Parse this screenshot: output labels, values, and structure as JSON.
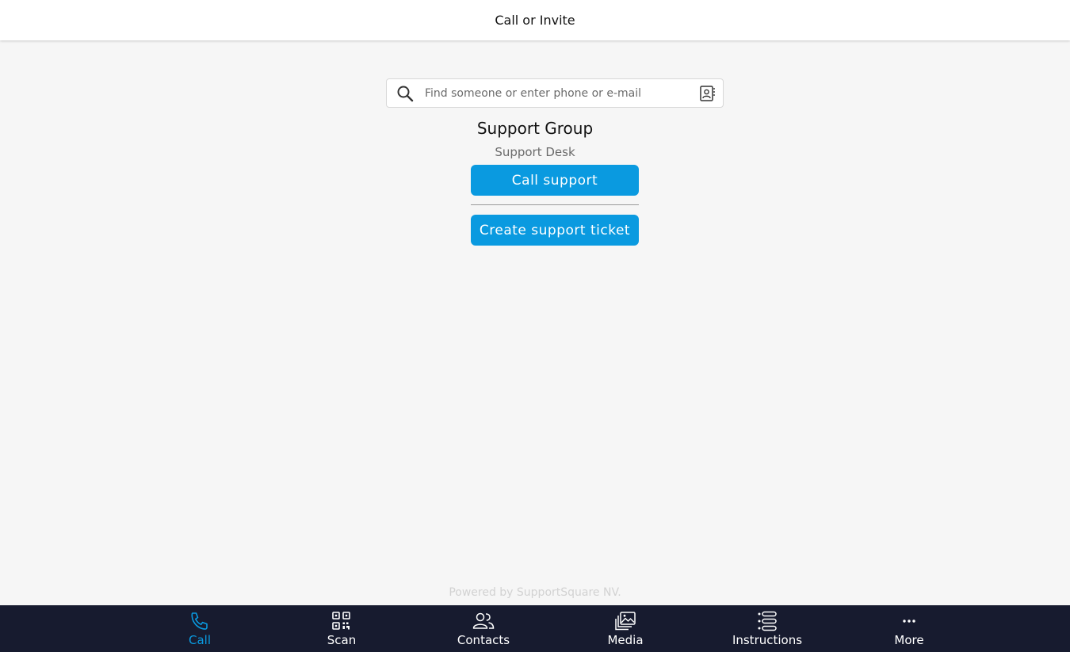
{
  "header": {
    "title": "Call or Invite"
  },
  "search": {
    "placeholder": "Find someone or enter phone or e-mail",
    "value": ""
  },
  "group": {
    "title": "Support Group",
    "subtitle": "Support Desk",
    "call_button": "Call support",
    "ticket_button": "Create support ticket"
  },
  "footer": {
    "powered_by": "Powered by SupportSquare NV."
  },
  "colors": {
    "accent": "#0a9ae0",
    "nav_background": "#171b2f",
    "page_background": "#f6f6f6"
  },
  "bottom_nav": {
    "active": "Call",
    "items": [
      {
        "label": "Call",
        "icon": "phone-icon"
      },
      {
        "label": "Scan",
        "icon": "qr-code-icon"
      },
      {
        "label": "Contacts",
        "icon": "contacts-icon"
      },
      {
        "label": "Media",
        "icon": "media-icon"
      },
      {
        "label": "Instructions",
        "icon": "instructions-icon"
      },
      {
        "label": "More",
        "icon": "more-icon"
      }
    ]
  }
}
